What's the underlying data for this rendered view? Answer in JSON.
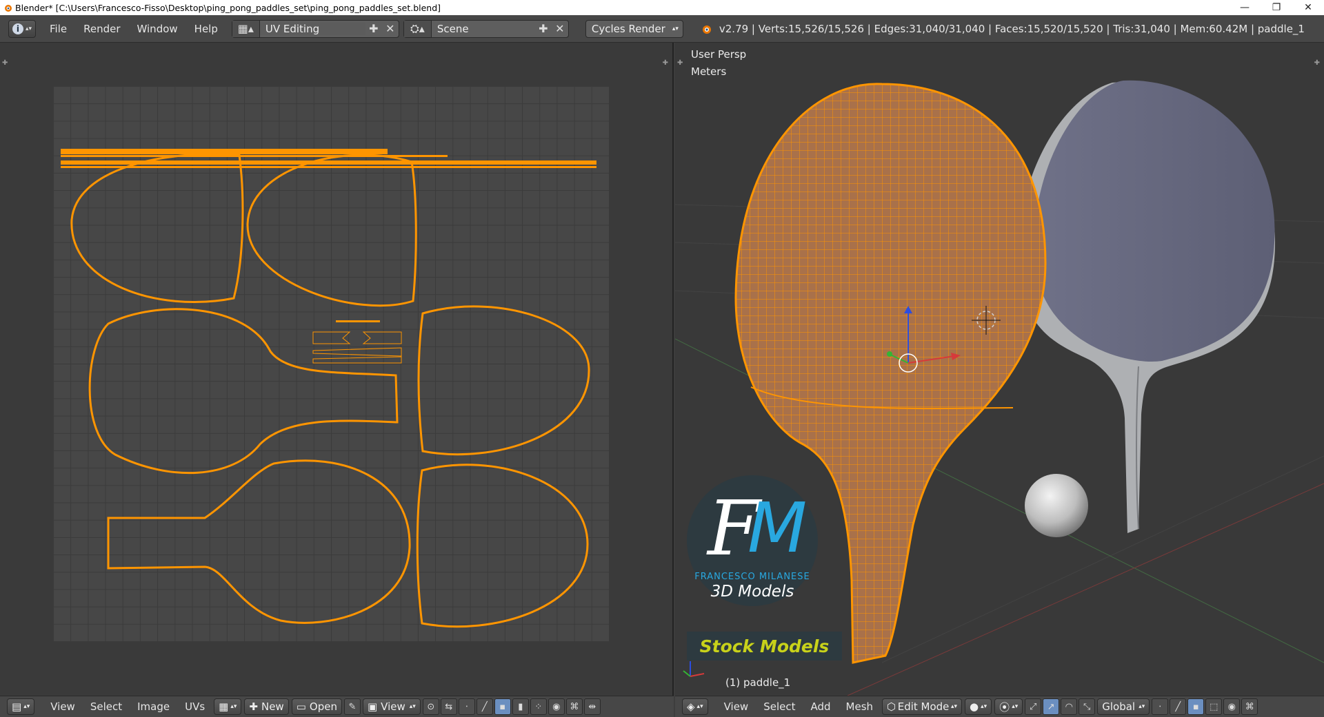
{
  "window": {
    "title": "Blender* [C:\\Users\\Francesco-Fisso\\Desktop\\ping_pong_paddles_set\\ping_pong_paddles_set.blend]",
    "minimize_glyph": "—",
    "maximize_glyph": "❐",
    "close_glyph": "✕"
  },
  "info_header": {
    "editor_icon": "info-icon",
    "menus": [
      "File",
      "Render",
      "Window",
      "Help"
    ],
    "screen_layout": "UV Editing",
    "scene": "Scene",
    "render_engine": "Cycles Render",
    "stats": "v2.79 | Verts:15,526/15,526 | Edges:31,040/31,040 | Faces:15,520/15,520 | Tris:31,040 | Mem:60.42M | paddle_1"
  },
  "viewport": {
    "view_name": "User Persp",
    "units": "Meters",
    "object_label": "(1) paddle_1"
  },
  "watermark": {
    "logo_letters_f": "F",
    "logo_letters_m": "M",
    "brand": "FRANCESCO MILANESE",
    "tagline": "3D Models",
    "banner": "Stock Models",
    "colors": {
      "f": "#ffffff",
      "m": "#29a8e0",
      "banner": "#c8d21a",
      "circle": "#2d3a40"
    }
  },
  "uv_header": {
    "menus": [
      "View",
      "Select",
      "Image",
      "UVs"
    ],
    "new_label": "New",
    "open_label": "Open",
    "view_label": "View"
  },
  "view3d_header": {
    "menus": [
      "View",
      "Select",
      "Add",
      "Mesh"
    ],
    "mode": "Edit Mode",
    "orientation": "Global"
  },
  "colors": {
    "uv_wire": "#ff9500",
    "selected_mesh": "#c78a4f"
  }
}
